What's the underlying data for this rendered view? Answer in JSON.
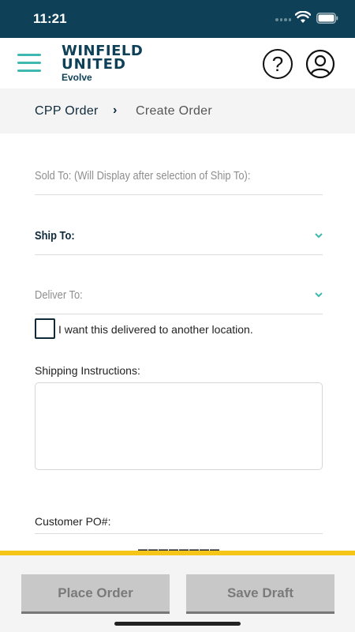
{
  "status_bar": {
    "time": "11:21"
  },
  "header": {
    "logo": {
      "line1": "WINFIELD",
      "line2": "UNITED",
      "line3": "Evolve"
    },
    "help_symbol": "?"
  },
  "breadcrumb": {
    "root": "CPP Order",
    "separator": "›",
    "current": "Create Order"
  },
  "form": {
    "sold_to_label": "Sold To: (Will Display after selection of Ship To):",
    "ship_to_label": "Ship To:",
    "deliver_to_label": "Deliver To:",
    "deliver_elsewhere_label": "I want this delivered to another location.",
    "shipping_instructions_label": "Shipping Instructions:",
    "shipping_instructions_value": "",
    "customer_po_label": "Customer PO#:"
  },
  "footer": {
    "place_order_label": "Place Order",
    "save_draft_label": "Save Draft"
  },
  "colors": {
    "status_bar": "#0e4157",
    "accent": "#3fb8b0",
    "strip": "#f5c518",
    "button_disabled": "#c8c8c8"
  },
  "icons": [
    "menu-icon",
    "wifi-icon",
    "battery-icon",
    "help-icon",
    "profile-icon",
    "chevron-right-icon",
    "chevron-down-icon"
  ]
}
